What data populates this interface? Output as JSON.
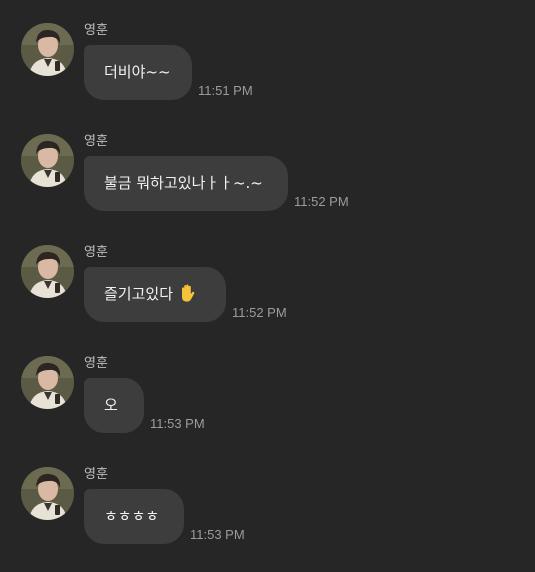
{
  "chat": {
    "messages": [
      {
        "sender": "영훈",
        "text": "더비야~~",
        "time": "11:51 PM"
      },
      {
        "sender": "영훈",
        "text": "불금 뭐하고있나ㅏㅏ~.~",
        "time": "11:52 PM"
      },
      {
        "sender": "영훈",
        "text": "즐기고있다",
        "emoji": "raised-hand-icon",
        "time": "11:52 PM"
      },
      {
        "sender": "영훈",
        "text": "오",
        "time": "11:53 PM"
      },
      {
        "sender": "영훈",
        "text": "ㅎㅎㅎㅎ",
        "time": "11:53 PM"
      }
    ]
  },
  "colors": {
    "background": "#262626",
    "bubble": "#3d3d3d",
    "bubble_text": "#f2f2f2",
    "sender_text": "#bdbdbd",
    "timestamp_text": "#9c9c9c",
    "emoji": "#f5c23a"
  }
}
